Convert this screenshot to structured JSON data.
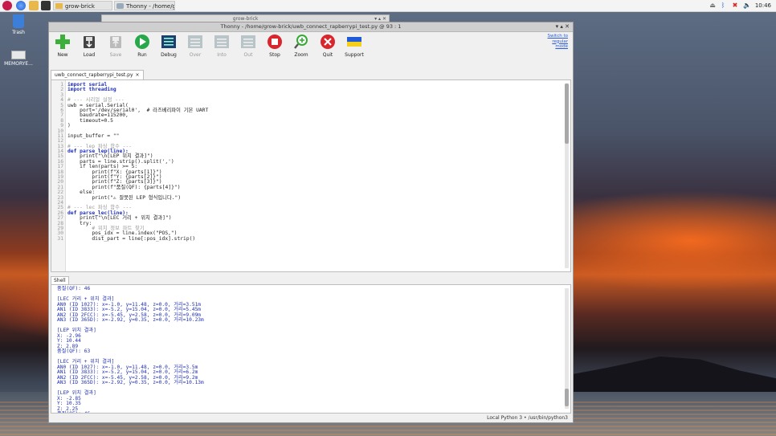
{
  "taskbar": {
    "buttons": [
      {
        "label": "grow-brick"
      },
      {
        "label": "Thonny - /home/gro..."
      }
    ],
    "clock": "10:46"
  },
  "desktop": {
    "icons": [
      {
        "label": "Trash"
      },
      {
        "label": "MEMORYE..."
      }
    ]
  },
  "background_window": {
    "title": "grow-brick"
  },
  "window": {
    "title": "Thonny - /home/grow-brick/uwb_connect_rapberrypi_test.py @ 93 : 1",
    "toolbar": [
      {
        "label": "New",
        "icon": "new-icon",
        "enabled": true
      },
      {
        "label": "Load",
        "icon": "load-icon",
        "enabled": true
      },
      {
        "label": "Save",
        "icon": "save-icon",
        "enabled": false
      },
      {
        "label": "Run",
        "icon": "run-icon",
        "enabled": true
      },
      {
        "label": "Debug",
        "icon": "debug-icon",
        "enabled": true
      },
      {
        "label": "Over",
        "icon": "step-over-icon",
        "enabled": false
      },
      {
        "label": "Into",
        "icon": "step-into-icon",
        "enabled": false
      },
      {
        "label": "Out",
        "icon": "step-out-icon",
        "enabled": false
      },
      {
        "label": "Stop",
        "icon": "stop-icon",
        "enabled": true
      },
      {
        "label": "Zoom",
        "icon": "zoom-icon",
        "enabled": true
      },
      {
        "label": "Quit",
        "icon": "quit-icon",
        "enabled": true
      },
      {
        "label": "Support",
        "icon": "ukraine-flag-icon",
        "enabled": true
      }
    ],
    "switch_mode": {
      "line1": "Switch to",
      "line2": "regular",
      "line3": "mode"
    },
    "editor_tab": {
      "label": "uwb_connect_rapberrypi_test.py",
      "close": "×"
    },
    "shell_tab": {
      "label": "Shell"
    },
    "status": "Local Python 3  •  /usr/bin/python3"
  },
  "code_lines": [
    {
      "n": "1",
      "text": "import serial"
    },
    {
      "n": "2",
      "text": "import threading"
    },
    {
      "n": "3",
      "text": ""
    },
    {
      "n": "4",
      "text": "# --- 시리얼 설정 ---"
    },
    {
      "n": "5",
      "text": "uwb = serial.Serial("
    },
    {
      "n": "6",
      "text": "    port='/dev/serial0',  # 라즈베리파이 기본 UART"
    },
    {
      "n": "7",
      "text": "    baudrate=115200,"
    },
    {
      "n": "8",
      "text": "    timeout=0.5"
    },
    {
      "n": "9",
      "text": ")"
    },
    {
      "n": "10",
      "text": ""
    },
    {
      "n": "11",
      "text": "input_buffer = \"\""
    },
    {
      "n": "12",
      "text": ""
    },
    {
      "n": "13",
      "text": "# --- lep 파싱 함수 ---"
    },
    {
      "n": "14",
      "text": "def parse_lep(line):"
    },
    {
      "n": "15",
      "text": "    print(\"\\n[LEP 위치 결과]\")"
    },
    {
      "n": "16",
      "text": "    parts = line.strip().split(',')"
    },
    {
      "n": "17",
      "text": "    if len(parts) >= 5:"
    },
    {
      "n": "18",
      "text": "        print(f\"X: {parts[1]}\")"
    },
    {
      "n": "19",
      "text": "        print(f\"Y: {parts[2]}\")"
    },
    {
      "n": "20",
      "text": "        print(f\"Z: {parts[3]}\")"
    },
    {
      "n": "21",
      "text": "        print(f\"품질(QF): {parts[4]}\")"
    },
    {
      "n": "22",
      "text": "    else:"
    },
    {
      "n": "23",
      "text": "        print(\"⚠ 잘못된 LEP 형식입니다.\")"
    },
    {
      "n": "24",
      "text": ""
    },
    {
      "n": "25",
      "text": "# --- lec 파싱 함수 ---"
    },
    {
      "n": "26",
      "text": "def parse_lec(line):"
    },
    {
      "n": "27",
      "text": "    print(\"\\n[LEC 거리 + 위치 결과]\")"
    },
    {
      "n": "28",
      "text": "    try:"
    },
    {
      "n": "29",
      "text": "        # 위치 정보 파트 찾기"
    },
    {
      "n": "30",
      "text": "        pos_idx = line.index(\"POS,\")"
    },
    {
      "n": "31",
      "text": "        dist_part = line[:pos_idx].strip()"
    }
  ],
  "shell_lines": [
    "품질(QF): 46",
    "",
    "[LEC 거리 + 위치 결과]",
    "AN0 (ID 1027): x=-1.0, y=11.48, z=0.0, 거리=3.51m",
    "AN1 (ID 3833): x=-5.2, y=15.04, z=0.0, 거리=5.45m",
    "AN2 (ID 2FCC): x=-5.45, y=2.58, z=0.0, 거리=9.09m",
    "AN3 (ID 365D): x=-2.92, y=0.35, z=0.0, 거리=10.23m",
    "",
    "[LEP 위치 결과]",
    "X: -2.96",
    "Y: 10.44",
    "Z: 2.89",
    "품질(QF): 63",
    "",
    "[LEC 거리 + 위치 결과]",
    "AN0 (ID 1027): x=-1.0, y=11.48, z=0.0, 거리=3.5m",
    "AN1 (ID 3833): x=-5.2, y=15.04, z=0.0, 거리=6.2m",
    "AN2 (ID 2FCC): x=-5.45, y=2.58, z=0.0, 거리=9.2m",
    "AN3 (ID 365D): x=-2.92, y=0.35, z=0.0, 거리=10.13m",
    "",
    "[LEP 위치 결과]",
    "X: -2.85",
    "Y: 10.35",
    "Z: 2.25",
    "품질(QF): 46"
  ]
}
